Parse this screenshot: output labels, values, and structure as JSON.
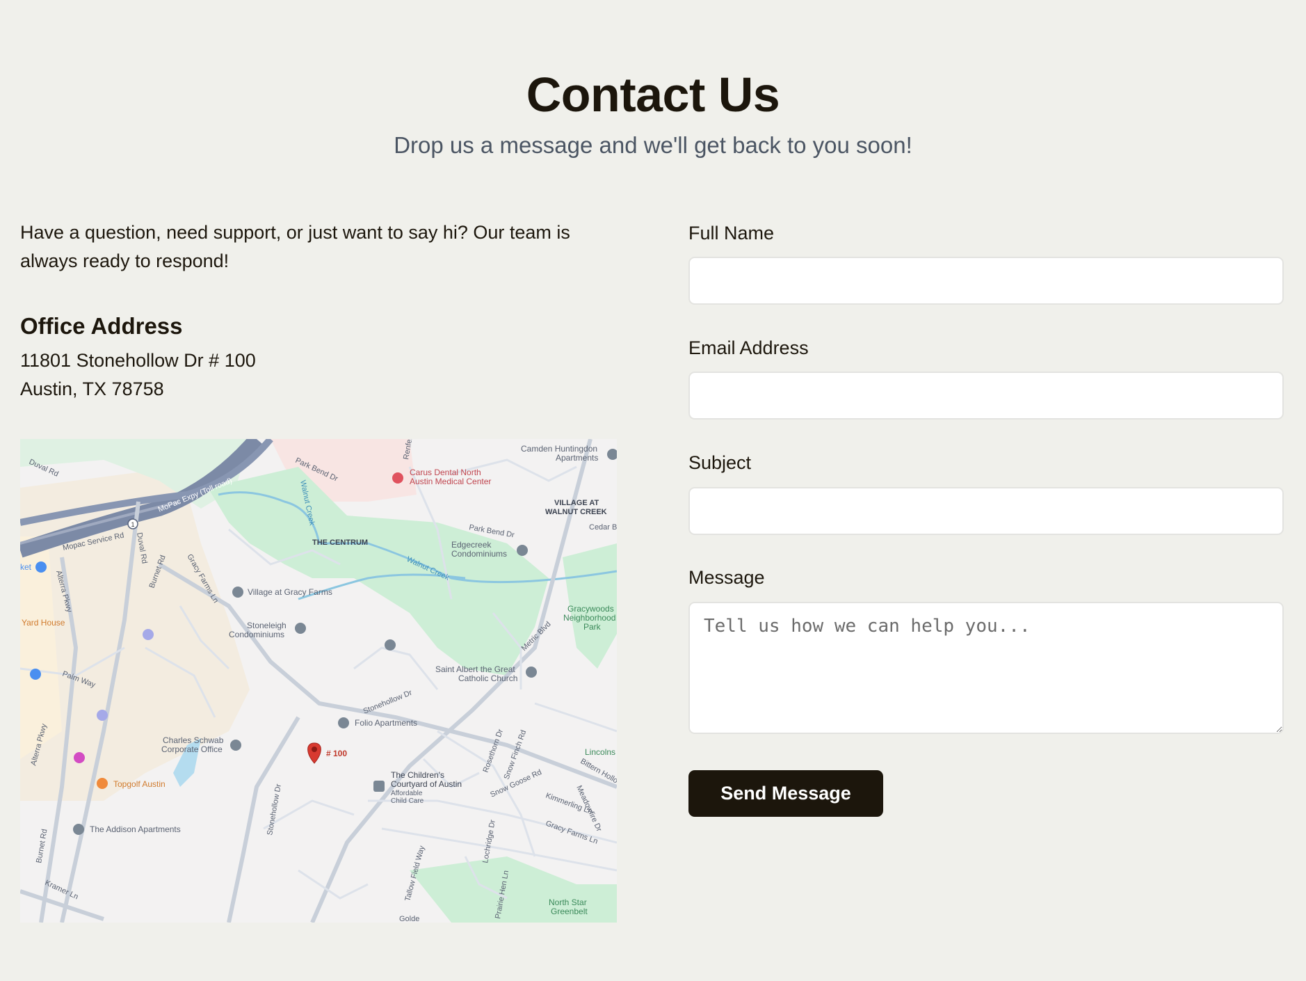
{
  "header": {
    "title": "Contact Us",
    "subtitle": "Drop us a message and we'll get back to you soon!"
  },
  "info": {
    "intro": "Have a question, need support, or just want to say hi? Our team is always ready to respond!",
    "office_heading": "Office Address",
    "address_line1": "11801 Stonehollow Dr # 100",
    "address_line2": "Austin, TX 78758"
  },
  "map": {
    "pin_label": "# 100",
    "places": {
      "carus": "Carus Dental North",
      "carus2": "Austin Medical Center",
      "camden": "Camden Huntingdon",
      "camden2": "Apartments",
      "village_walnut": "VILLAGE AT",
      "village_walnut2": "WALNUT CREEK",
      "centrum": "THE CENTRUM",
      "edgecreek": "Edgecreek",
      "edgecreek2": "Condominiums",
      "gracy": "Village at Gracy Farms",
      "stoneleigh": "Stoneleigh",
      "stoneleigh2": "Condominiums",
      "saint_albert": "Saint Albert the Great",
      "saint_albert2": "Catholic Church",
      "gracywoods": "Gracywoods",
      "gracywoods2": "Neighborhood",
      "gracywoods3": "Park",
      "folio": "Folio Apartments",
      "schwab": "Charles Schwab",
      "schwab2": "Corporate Office",
      "topgolf": "Topgolf Austin",
      "childrens": "The Children's",
      "childrens2": "Courtyard of Austin",
      "childrens3": "Affordable",
      "childrens4": "Child Care",
      "addison": "The Addison Apartments",
      "yard_house": "Yard House",
      "lincoln": "Lincolns",
      "north_star": "North Star",
      "north_star2": "Greenbelt",
      "ket": "ket"
    },
    "roads": {
      "duval": "Duval Rd",
      "duval_v": "Duval Rd",
      "mopac": "MoPac Expy (Toll road)",
      "mopac_service": "Mopac Service Rd",
      "park_bend": "Park Bend Dr",
      "park_bend2": "Park Bend Dr",
      "walnut_creek": "Walnut Creek",
      "walnut_creek2": "Walnut Creek",
      "burnet": "Burnet Rd",
      "burnet2": "Burnet Rd",
      "gracy_farms": "Gracy Farms Ln",
      "gracy_farms2": "Gracy Farms Ln",
      "alterra": "Alterra Pkwy",
      "alterra2": "Alterra Pkwy",
      "palm_way": "Palm Way",
      "metric": "Metric Blvd",
      "stonehollow": "Stonehollow Dr",
      "stonehollow2": "Stonehollow Dr",
      "kramer": "Kramer Ln",
      "cedar": "Cedar Be",
      "renfert": "Renfer",
      "bittern": "Bittern Hollow",
      "kimmerling": "Kimmerling Ln",
      "meadowfire": "Meadowfire Dr",
      "rosethorn": "Rosethorn Dr",
      "snowfinch": "Snow Finch Rd",
      "snowgoose": "Snow Goose Rd",
      "lochridge": "Lochridge Dr",
      "tallow": "Tallow Field Way",
      "prairie": "Prairie Hen Ln",
      "golde": "Golde",
      "highway_shield": "1"
    }
  },
  "form": {
    "full_name_label": "Full Name",
    "email_label": "Email Address",
    "subject_label": "Subject",
    "message_label": "Message",
    "message_placeholder": "Tell us how we can help you...",
    "submit_label": "Send Message"
  }
}
